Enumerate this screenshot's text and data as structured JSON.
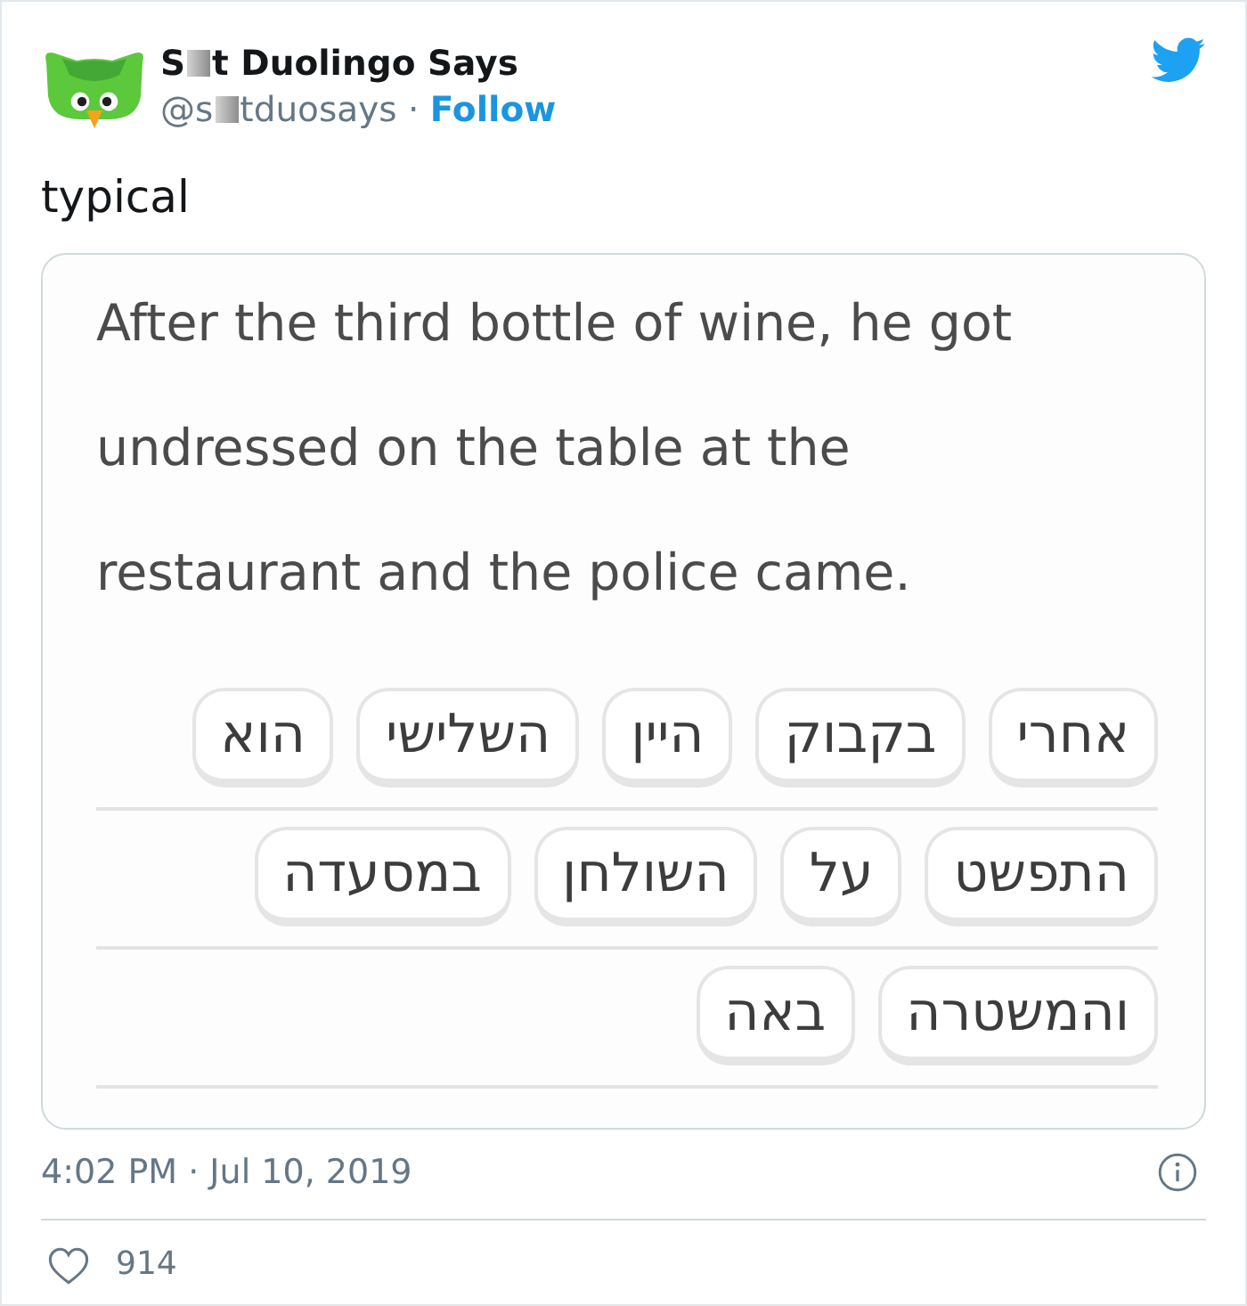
{
  "author": {
    "name": {
      "before_censor": "S",
      "after_censor": "t Duolingo Says"
    },
    "handle": {
      "before_censor": "@s",
      "after_censor": "tduosays"
    },
    "separator": "·",
    "follow_label": "Follow"
  },
  "tweet_text": "typical",
  "exercise": {
    "prompt": "After the third bottle of wine, he got undressed on the table at the restaurant and the police came.",
    "word_rows": [
      [
        "אחרי",
        "בקבוק",
        "היין",
        "השלישי",
        "הוא"
      ],
      [
        "התפשט",
        "על",
        "השולחן",
        "במסעדה"
      ],
      [
        "והמשטרה",
        "באה"
      ]
    ]
  },
  "timestamp": "4:02 PM · Jul 10, 2019",
  "likes": {
    "count": "914"
  }
}
